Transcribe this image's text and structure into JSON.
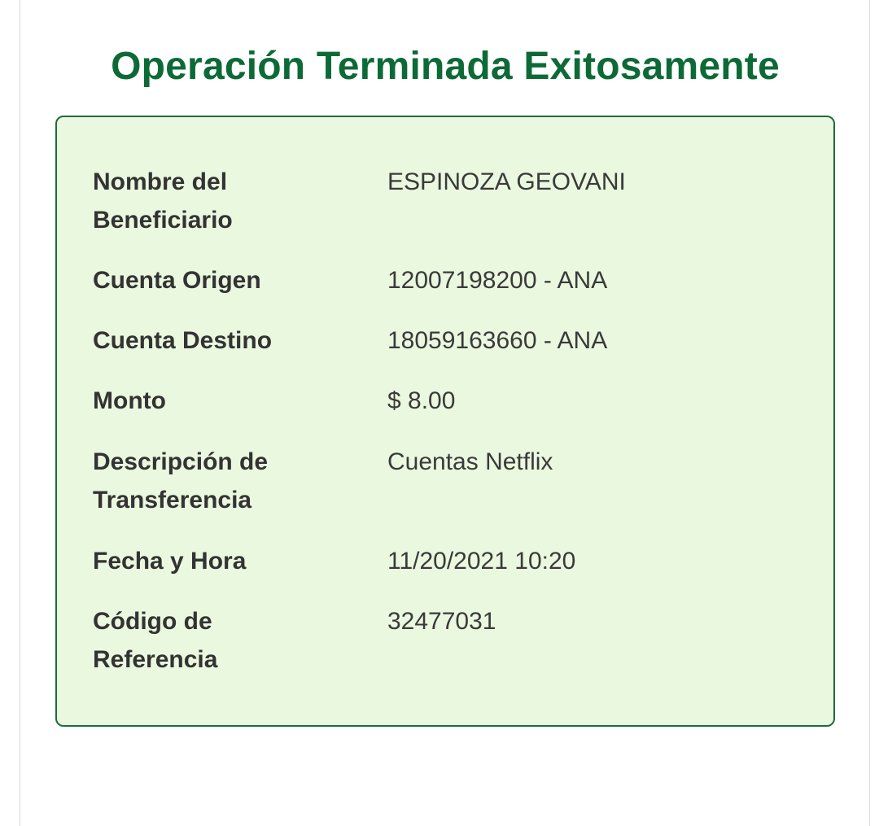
{
  "header": {
    "title": "Operación Terminada Exitosamente"
  },
  "details": {
    "rows": [
      {
        "label_line1": "Nombre del",
        "label_line2": "Beneficiario",
        "value": "ESPINOZA GEOVANI"
      },
      {
        "label_line1": "Cuenta Origen",
        "label_line2": "",
        "value": "12007198200 - ANA"
      },
      {
        "label_line1": "Cuenta Destino",
        "label_line2": "",
        "value": "18059163660 - ANA"
      },
      {
        "label_line1": "Monto",
        "label_line2": "",
        "value": "$ 8.00"
      },
      {
        "label_line1": "Descripción de",
        "label_line2": "Transferencia",
        "value": "Cuentas Netflix"
      },
      {
        "label_line1": "Fecha y Hora",
        "label_line2": "",
        "value": "11/20/2021 10:20"
      },
      {
        "label_line1": "Código de",
        "label_line2": "Referencia",
        "value": "32477031"
      }
    ]
  },
  "colors": {
    "title": "#0d6a37",
    "card_border": "#1e6b3f",
    "card_background": "#eaf8df"
  }
}
